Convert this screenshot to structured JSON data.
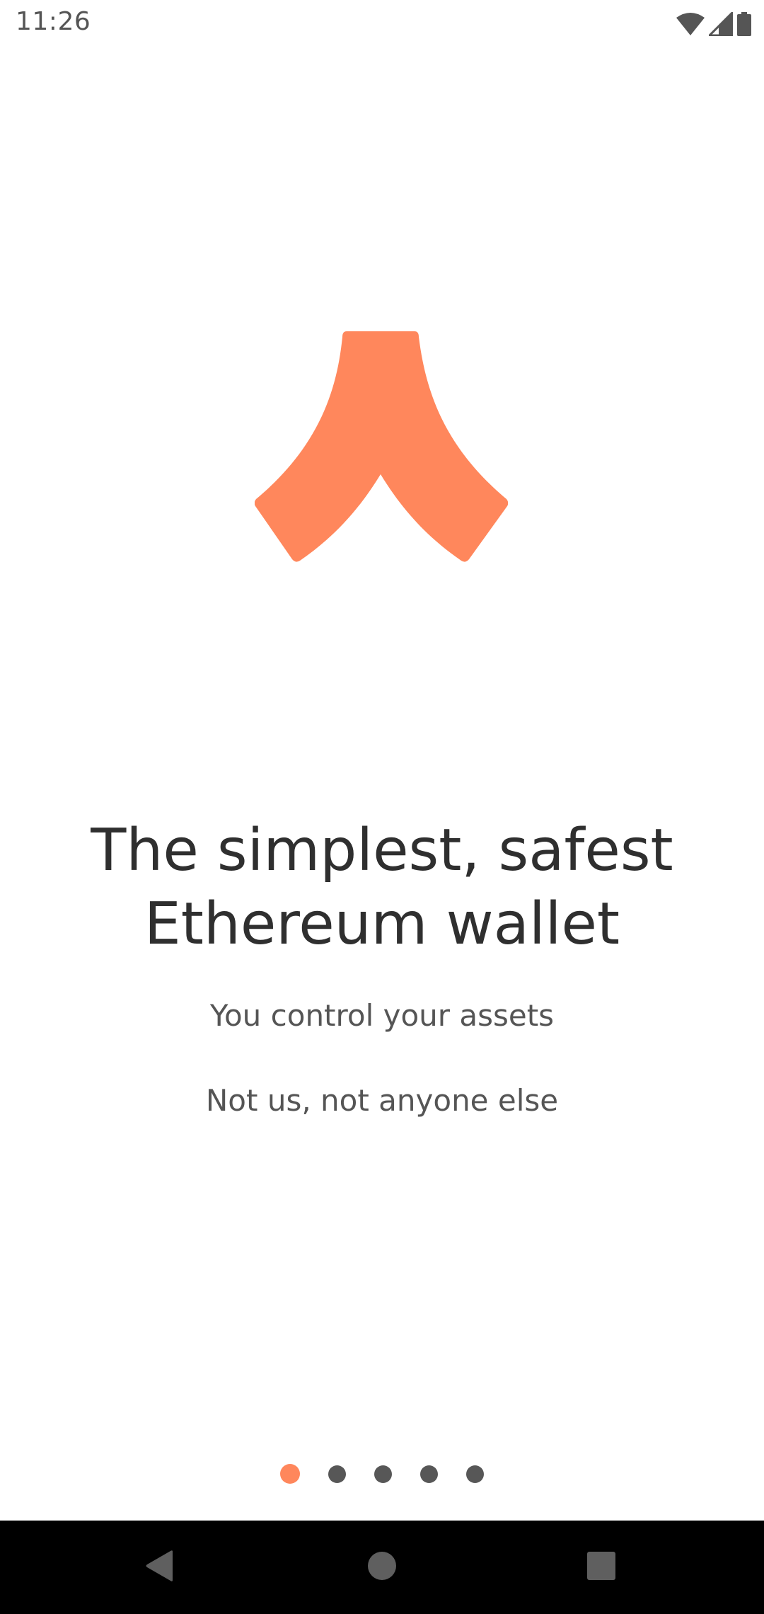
{
  "status_bar": {
    "time": "11:26",
    "icons": [
      "wifi-icon",
      "cell-signal-icon",
      "battery-icon"
    ]
  },
  "logo": {
    "icon": "wallet-logo-icon",
    "color": "#ff875c"
  },
  "onboarding": {
    "headline_line1": "The simplest, safest",
    "headline_line2": "Ethereum wallet",
    "subtext_1": "You control your assets",
    "subtext_2": "Not us, not anyone else"
  },
  "pager": {
    "page_count": 5,
    "current_page": 1,
    "active_color": "#ff875c",
    "inactive_color": "#575757"
  },
  "nav_bar": {
    "buttons": [
      "back-icon",
      "home-icon",
      "recents-icon"
    ]
  }
}
